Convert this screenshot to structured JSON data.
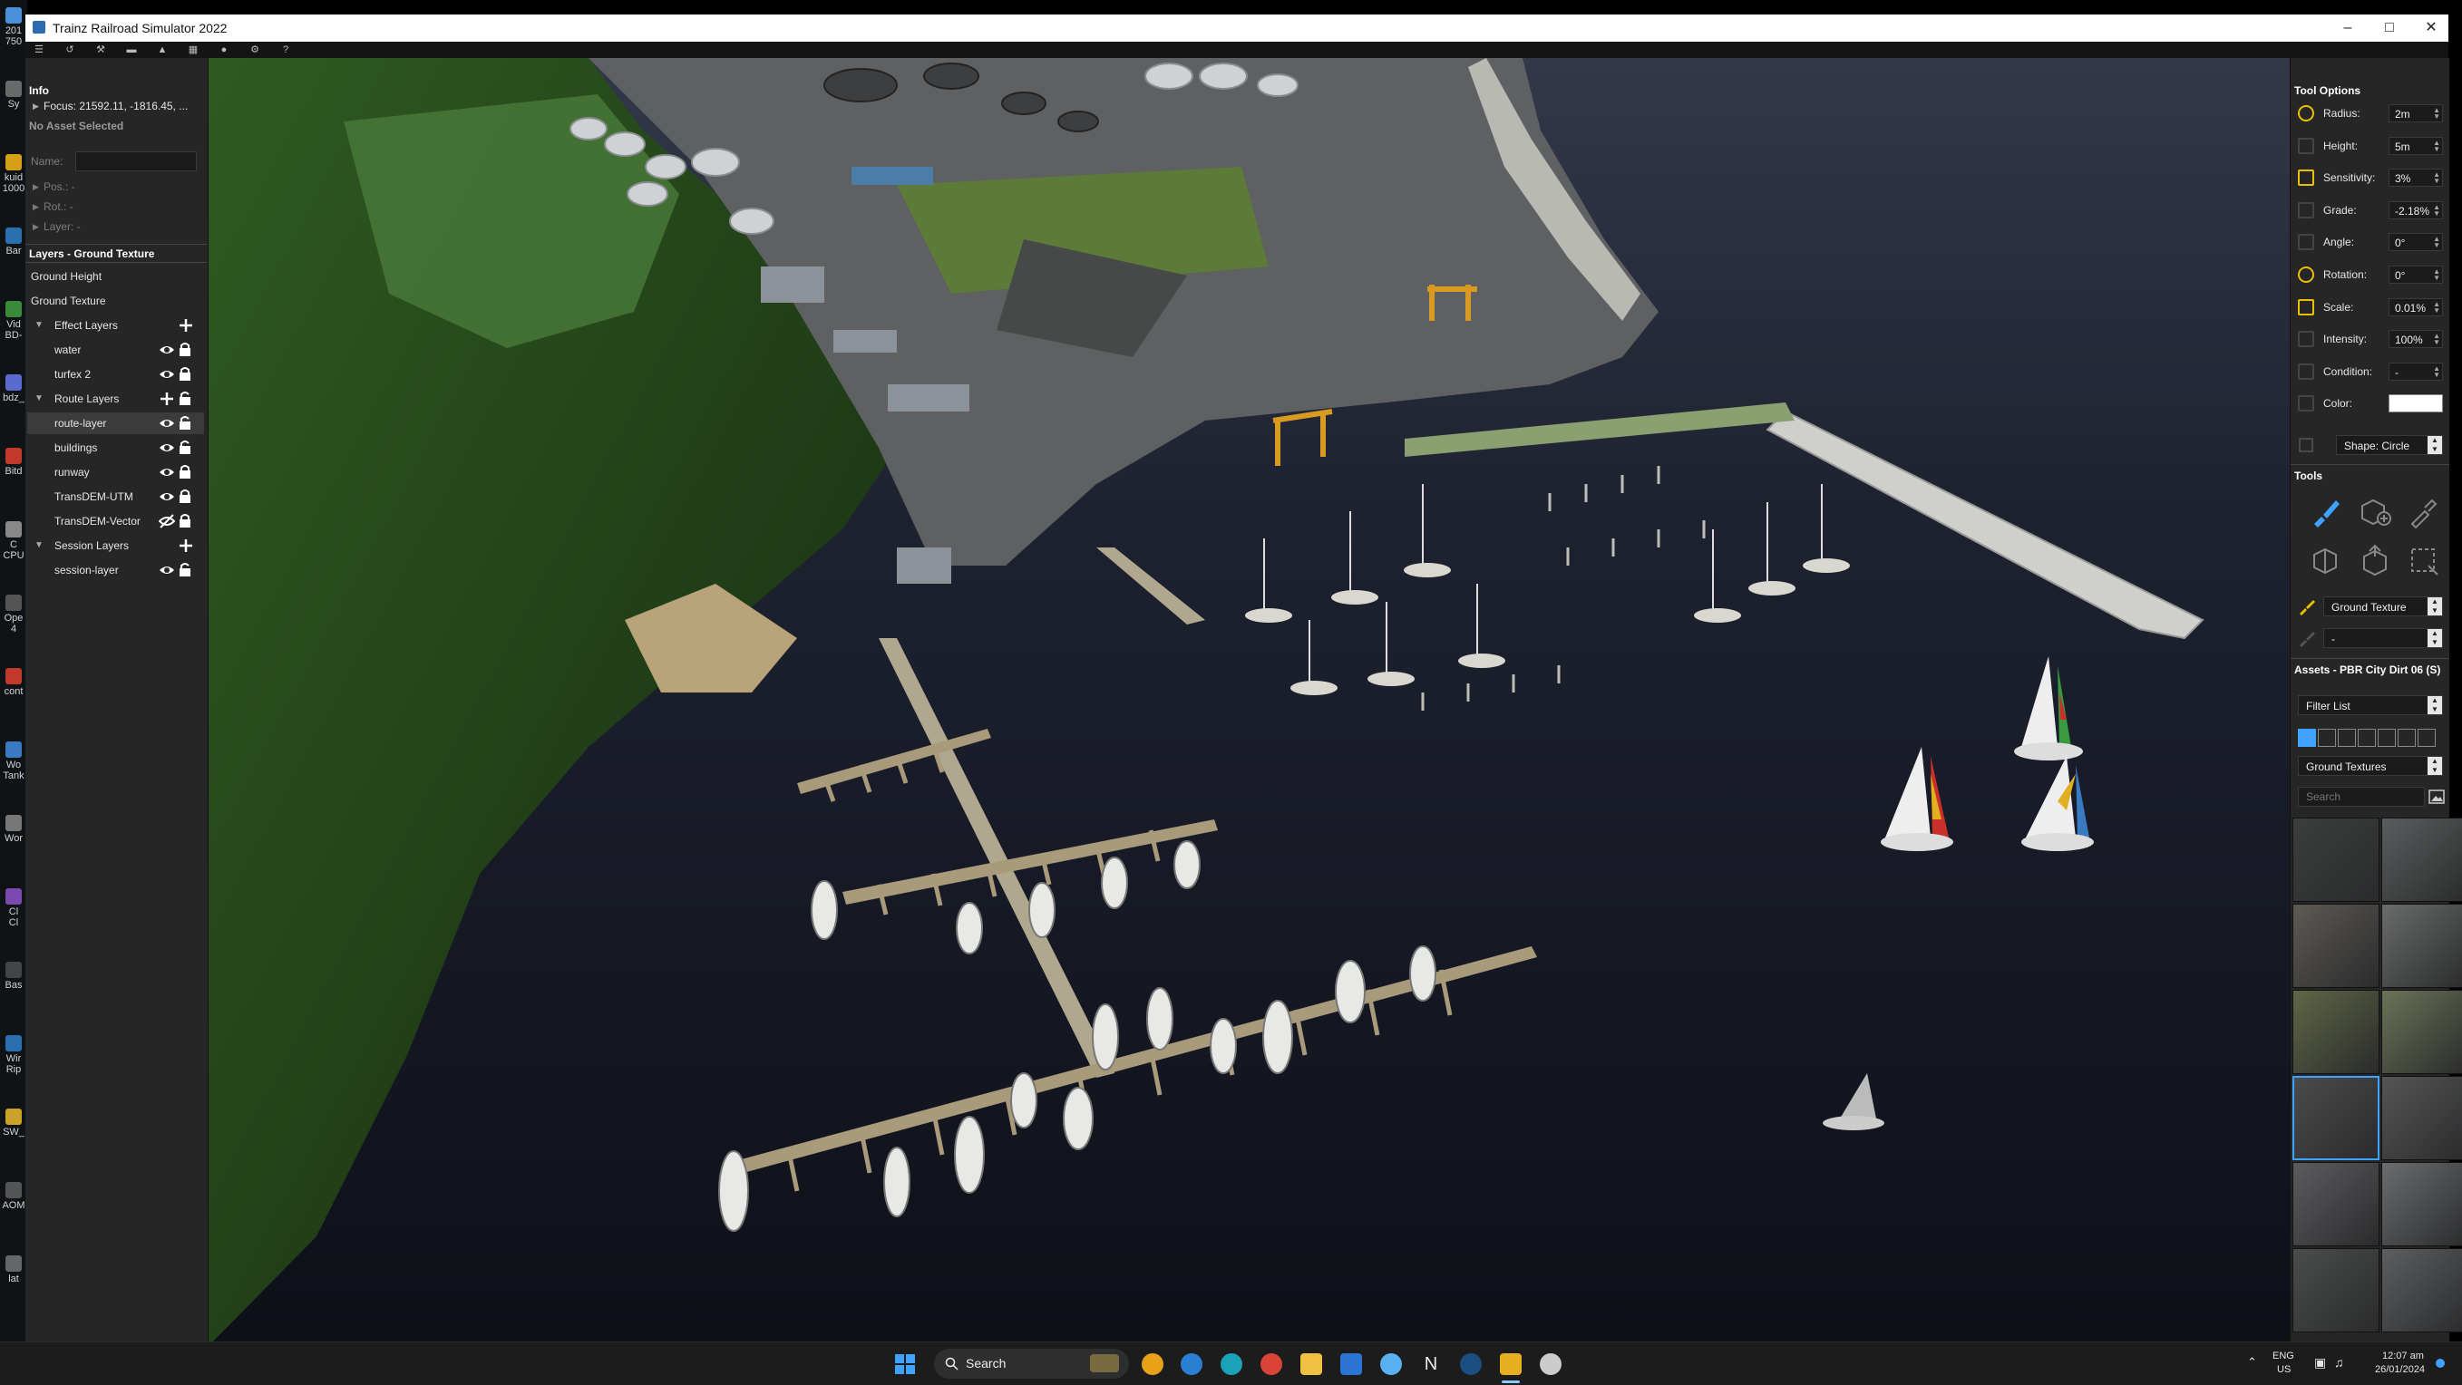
{
  "window": {
    "title": "Trainz Railroad Simulator 2022"
  },
  "desktop": {
    "items": [
      "201\n750",
      "Sy",
      "kuid\n1000",
      "Bar",
      "Vid\nBD-",
      "bdz_",
      "Bitd",
      "C\nCPU",
      "Ope\n4",
      "cont",
      "Wo\nTank",
      "Wor",
      "Cl\nCl",
      "Bas",
      "Wir\nRip",
      "SW_",
      "AOM",
      "lat"
    ]
  },
  "info": {
    "header": "Info",
    "focus": "Focus: 21592.11, -1816.45, ...",
    "no_asset": "No Asset Selected",
    "name_label": "Name:",
    "name_value": "",
    "pos": "Pos.: -",
    "rot": "Rot.: -",
    "layer": "Layer: -"
  },
  "layers": {
    "header": "Layers - Ground Texture",
    "ground_height": "Ground Height",
    "ground_texture": "Ground Texture",
    "effect_group": "Effect Layers",
    "effect_items": [
      "water",
      "turfex 2"
    ],
    "route_group": "Route Layers",
    "route_items": [
      "route-layer",
      "buildings",
      "runway",
      "TransDEM-UTM",
      "TransDEM-Vector"
    ],
    "session_group": "Session Layers",
    "session_items": [
      "session-layer"
    ]
  },
  "tool_options": {
    "header": "Tool Options",
    "rows": [
      {
        "label": "Radius:",
        "value": "2m"
      },
      {
        "label": "Height:",
        "value": "5m"
      },
      {
        "label": "Sensitivity:",
        "value": "3%"
      },
      {
        "label": "Grade:",
        "value": "-2.18%"
      },
      {
        "label": "Angle:",
        "value": "0°"
      },
      {
        "label": "Rotation:",
        "value": "0°"
      },
      {
        "label": "Scale:",
        "value": "0.01%"
      },
      {
        "label": "Intensity:",
        "value": "100%"
      },
      {
        "label": "Condition:",
        "value": "-"
      },
      {
        "label": "Color:",
        "value": ""
      }
    ],
    "shape": "Shape: Circle",
    "accent": "#e8c100"
  },
  "tools": {
    "header": "Tools",
    "icons": [
      "paint-brush-icon",
      "add-object-icon",
      "eyedropper-icon",
      "object-stack-icon",
      "object-group-icon",
      "selection-box-icon"
    ],
    "primary": "Ground Texture",
    "secondary": "-"
  },
  "assets": {
    "header": "Assets - PBR City Dirt 06 (S)",
    "filter": "Filter List",
    "category": "Ground Textures",
    "search_placeholder": "Search",
    "thumb_colors": [
      "#3c3e3e",
      "#5a5d5e",
      "#5e5a55",
      "#6a6c6b",
      "#5f6646",
      "#6b7357",
      "#4a4b4c",
      "#545556",
      "#5b5c5e",
      "#6a6c6e",
      "#4a4c4d",
      "#5c5e60"
    ],
    "selected_index": 6
  },
  "taskbar": {
    "search": "Search",
    "lang_top": "ENG",
    "lang_bottom": "US",
    "time": "12:07 am",
    "date": "26/01/2024"
  }
}
